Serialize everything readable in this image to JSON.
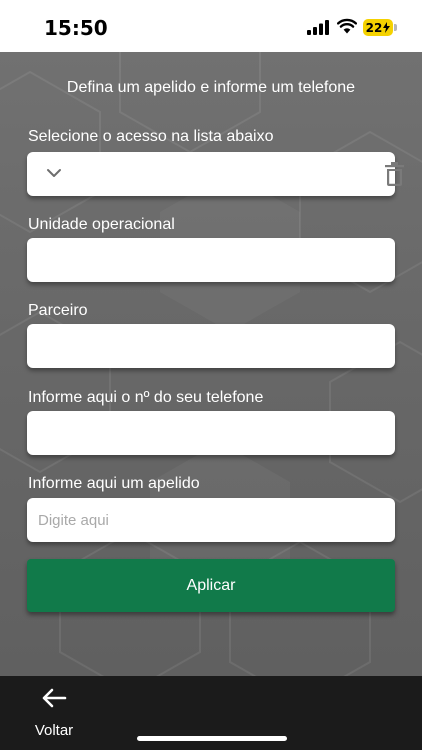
{
  "status_bar": {
    "time": "15:50",
    "battery": "22"
  },
  "form": {
    "subtitle": "Defina um apelido e informe um telefone",
    "access_label": "Selecione o acesso na lista abaixo",
    "access_value": "",
    "unit_label": "Unidade operacional",
    "unit_value": "",
    "partner_label": "Parceiro",
    "partner_value": "",
    "phone_label": "Informe aqui o nº do seu telefone",
    "phone_value": "",
    "nickname_label": "Informe aqui um apelido",
    "nickname_placeholder": "Digite aqui",
    "nickname_value": "",
    "apply_label": "Aplicar"
  },
  "footer": {
    "back_label": "Voltar"
  },
  "colors": {
    "accent": "#117a4a",
    "background": "#6b6b6b",
    "bottom_bar": "#1b1b1b",
    "battery": "#f5d200"
  },
  "icons": {
    "signal": "cellular-signal-icon",
    "wifi": "wifi-icon",
    "battery": "battery-charging-icon",
    "select": "chevron-down-icon",
    "delete": "trash-icon",
    "back": "arrow-left-icon"
  }
}
